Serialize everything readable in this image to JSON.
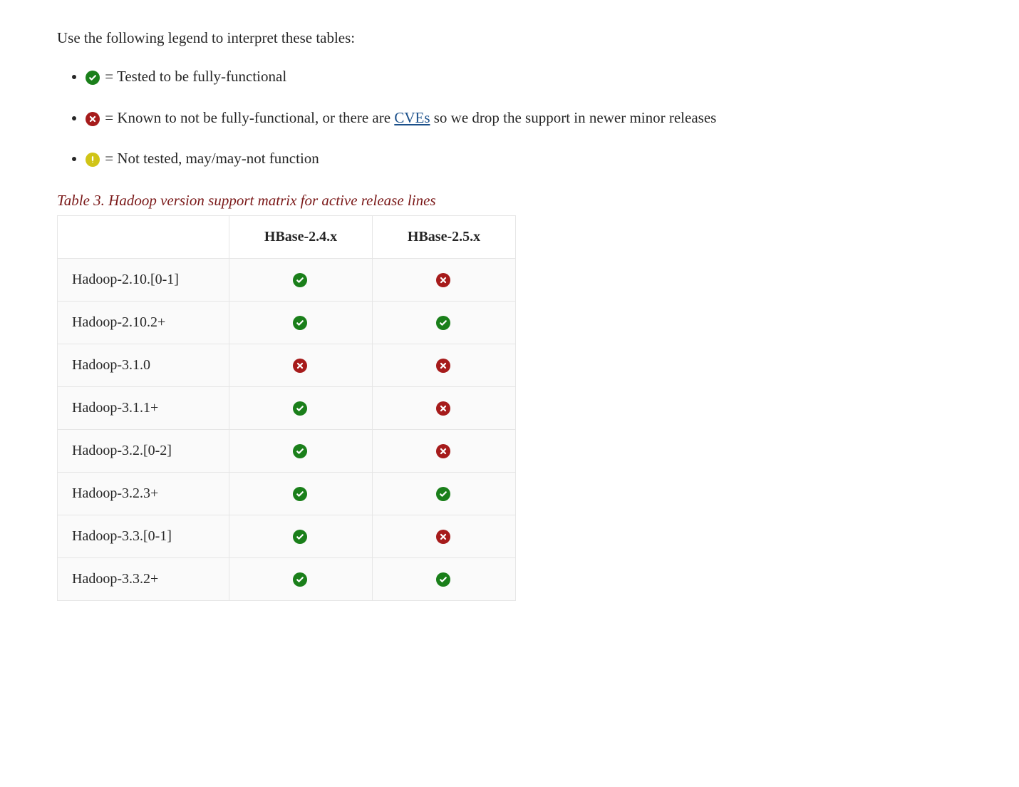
{
  "intro": "Use the following legend to interpret these tables:",
  "legend": {
    "ok_text": " = Tested to be fully-functional",
    "bad_prefix": " = Known to not be fully-functional, or there are ",
    "bad_link": "CVEs",
    "bad_suffix": " so we drop the support in newer minor releases",
    "warn_text": " = Not tested, may/may-not function"
  },
  "table": {
    "title": "Table 3. Hadoop version support matrix for active release lines",
    "columns": [
      "",
      "HBase-2.4.x",
      "HBase-2.5.x"
    ],
    "rows": [
      {
        "label": "Hadoop-2.10.[0-1]",
        "cells": [
          "ok",
          "bad"
        ]
      },
      {
        "label": "Hadoop-2.10.2+",
        "cells": [
          "ok",
          "ok"
        ]
      },
      {
        "label": "Hadoop-3.1.0",
        "cells": [
          "bad",
          "bad"
        ]
      },
      {
        "label": "Hadoop-3.1.1+",
        "cells": [
          "ok",
          "bad"
        ]
      },
      {
        "label": "Hadoop-3.2.[0-2]",
        "cells": [
          "ok",
          "bad"
        ]
      },
      {
        "label": "Hadoop-3.2.3+",
        "cells": [
          "ok",
          "ok"
        ]
      },
      {
        "label": "Hadoop-3.3.[0-1]",
        "cells": [
          "ok",
          "bad"
        ]
      },
      {
        "label": "Hadoop-3.3.2+",
        "cells": [
          "ok",
          "ok"
        ]
      }
    ]
  }
}
